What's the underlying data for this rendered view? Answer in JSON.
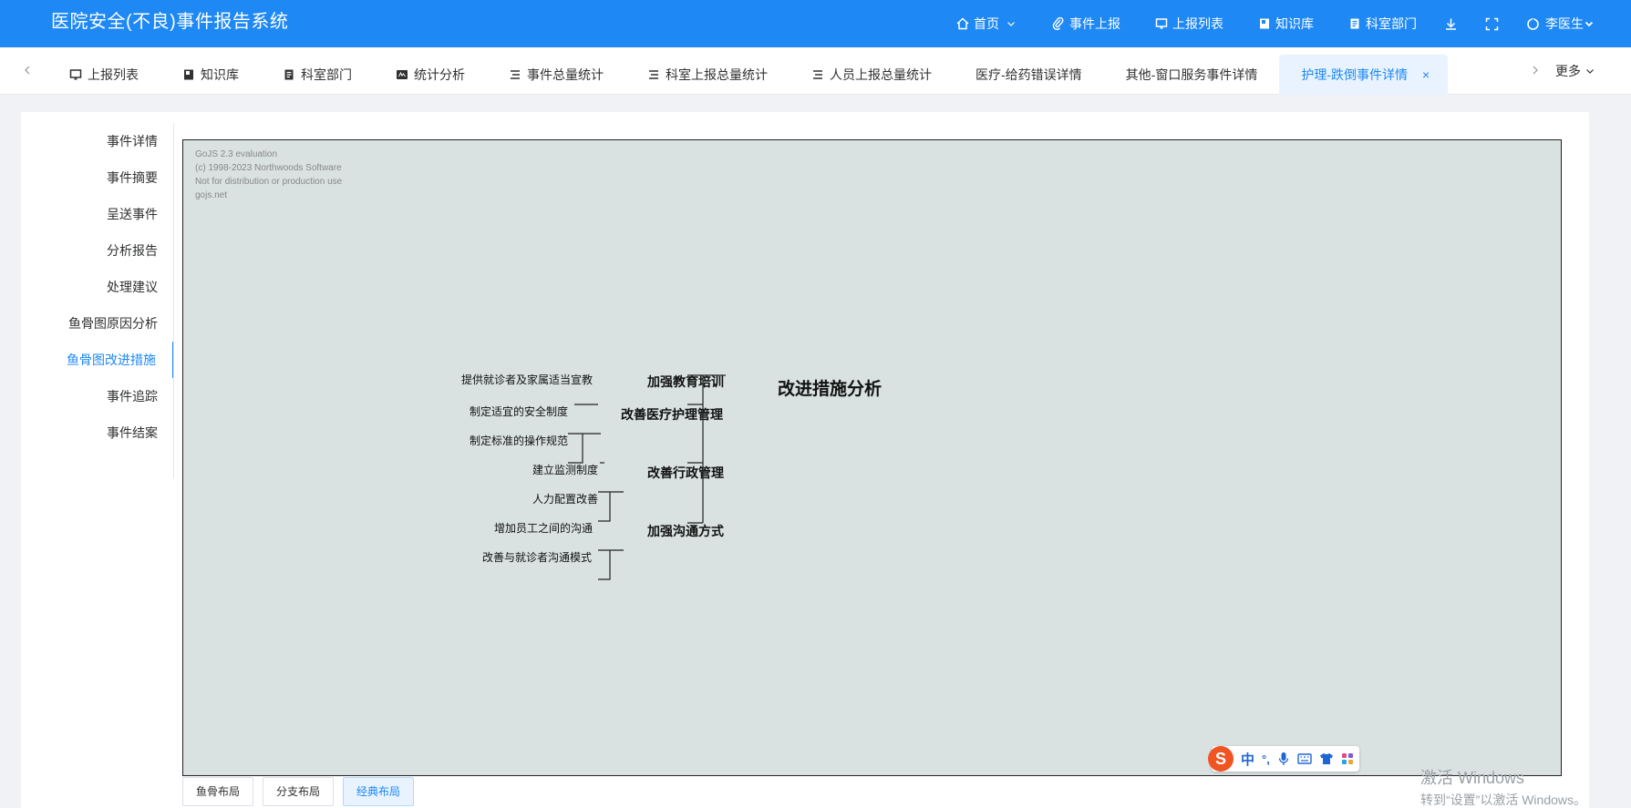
{
  "header": {
    "title": "医院安全(不良)事件报告系统",
    "nav": [
      {
        "label": "首页",
        "icon": "home-icon"
      },
      {
        "label": "事件上报",
        "icon": "paperclip-icon"
      },
      {
        "label": "上报列表",
        "icon": "monitor-icon"
      },
      {
        "label": "知识库",
        "icon": "book-icon"
      },
      {
        "label": "科室部门",
        "icon": "document-icon"
      }
    ],
    "user": "李医生"
  },
  "tabs": [
    {
      "label": "上报列表",
      "icon": "monitor-icon"
    },
    {
      "label": "知识库",
      "icon": "book-icon"
    },
    {
      "label": "科室部门",
      "icon": "document-icon"
    },
    {
      "label": "统计分析",
      "icon": "chart-icon"
    },
    {
      "label": "事件总量统计",
      "icon": "list-icon"
    },
    {
      "label": "科室上报总量统计",
      "icon": "list-icon"
    },
    {
      "label": "人员上报总量统计",
      "icon": "list-icon"
    },
    {
      "label": "医疗-给药错误详情",
      "icon": ""
    },
    {
      "label": "其他-窗口服务事件详情",
      "icon": ""
    },
    {
      "label": "护理-跌倒事件详情",
      "icon": "",
      "active": true
    }
  ],
  "more_label": "更多",
  "sidebar": {
    "items": [
      {
        "label": "事件详情"
      },
      {
        "label": "事件摘要"
      },
      {
        "label": "呈送事件"
      },
      {
        "label": "分析报告"
      },
      {
        "label": "处理建议"
      },
      {
        "label": "鱼骨图原因分析"
      },
      {
        "label": "鱼骨图改进措施",
        "active": true
      },
      {
        "label": "事件追踪"
      },
      {
        "label": "事件结案"
      }
    ]
  },
  "canvas": {
    "eval_lines": [
      "GoJS 2.3 evaluation",
      "(c) 1998-2023 Northwoods Software",
      "Not for distribution or production use",
      "gojs.net"
    ]
  },
  "diagram": {
    "root": "改进措施分析",
    "branches": [
      {
        "label": "加强教育培训",
        "children": [
          "提供就诊者及家属适当宣教"
        ]
      },
      {
        "label": "改善医疗护理管理",
        "children": [
          "制定适宜的安全制度",
          "制定标准的操作规范"
        ]
      },
      {
        "label": "改善行政管理",
        "children": [
          "建立监测制度",
          "人力配置改善"
        ]
      },
      {
        "label": "加强沟通方式",
        "children": [
          "增加员工之间的沟通",
          "改善与就诊者沟通模式"
        ]
      }
    ]
  },
  "ime": {
    "lang": "中",
    "punct": "°,"
  },
  "layout_buttons": [
    {
      "label": "鱼骨布局"
    },
    {
      "label": "分支布局"
    },
    {
      "label": "经典布局",
      "active": true
    }
  ],
  "watermark": {
    "line1": "激活 Windows",
    "line2": "转到“设置”以激活 Windows。"
  }
}
